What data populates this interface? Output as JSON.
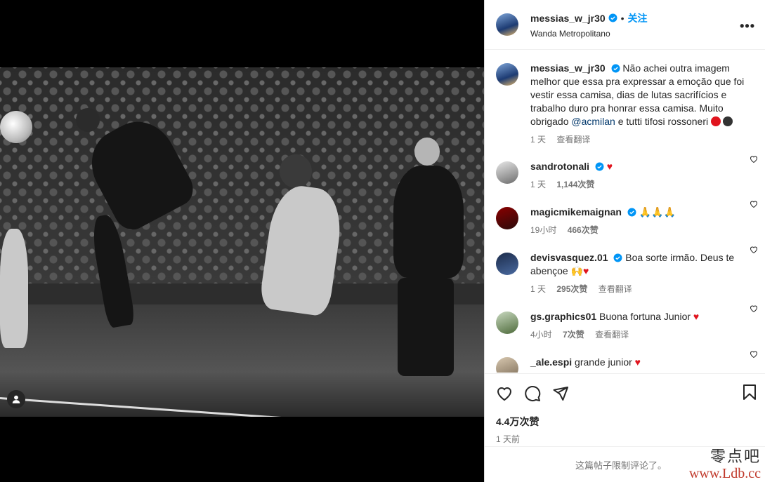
{
  "post": {
    "username": "messias_w_jr30",
    "follow_label": "关注",
    "location": "Wanda Metropolitano",
    "more": "•••"
  },
  "caption": {
    "username": "messias_w_jr30",
    "text_before": "Não achei outra imagem melhor que essa pra expressar a emoção que foi vestir essa camisa, dias de lutas sacrifícios e trabalho duro pra honrar essa camisa. Muito obrigado",
    "mention": "@acmilan",
    "text_after": "e tutti tifosi rossoneri",
    "time": "1 天",
    "translate": "查看翻译"
  },
  "comments": [
    {
      "username": "sandrotonali",
      "verified": true,
      "text": "",
      "emoji": "♥",
      "time": "1 天",
      "likes": "1,144次赞",
      "translate": ""
    },
    {
      "username": "magicmikemaignan",
      "verified": true,
      "text": "",
      "emoji": "🙏🙏🙏",
      "time": "19小时",
      "likes": "466次赞",
      "translate": ""
    },
    {
      "username": "devisvasquez.01",
      "verified": true,
      "text": "Boa sorte irmão. Deus te abençoe",
      "emoji": "🙌♥",
      "time": "1 天",
      "likes": "295次赞",
      "translate": "查看翻译"
    },
    {
      "username": "gs.graphics01",
      "verified": false,
      "text": "Buona fortuna Junior",
      "emoji": "♥",
      "time": "4小时",
      "likes": "7次赞",
      "translate": "查看翻译"
    },
    {
      "username": "_ale.espi",
      "verified": false,
      "text": "grande junior",
      "emoji": "♥",
      "time": "",
      "likes": "",
      "translate": ""
    }
  ],
  "stats": {
    "likes": "4.4万次赞",
    "time": "1 天前"
  },
  "footer": {
    "limited": "这篇帖子限制评论了。"
  },
  "watermark": {
    "line1": "零点吧",
    "line2": "www.Ldb.cc"
  },
  "colors": {
    "accent": "#0095f6",
    "heart": "#e0141e"
  }
}
